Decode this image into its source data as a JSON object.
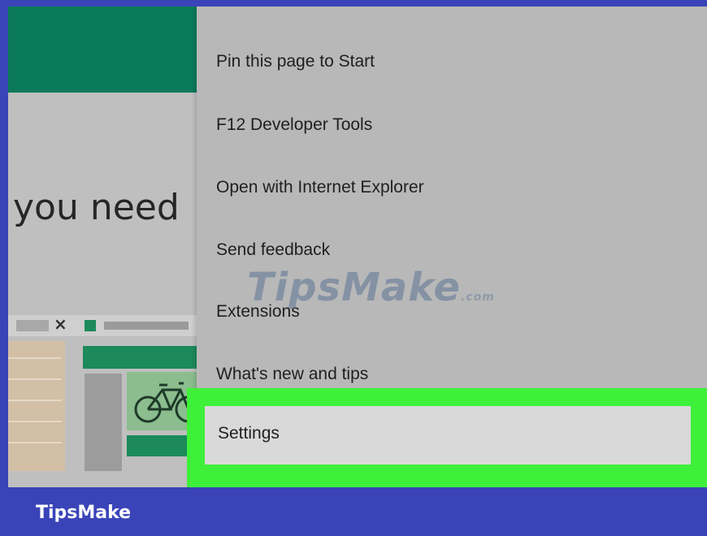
{
  "page": {
    "heading": "you need"
  },
  "menu": {
    "items": [
      {
        "label": "Pin this page to Start"
      },
      {
        "label": "F12 Developer Tools"
      },
      {
        "label": "Open with Internet Explorer"
      },
      {
        "label": "Send feedback"
      },
      {
        "label": "Extensions"
      },
      {
        "label": "What's new and tips"
      }
    ],
    "settings_label": "Settings"
  },
  "footer": {
    "brand": "TipsMake"
  },
  "watermark": {
    "text": "TipsMake",
    "suffix": ".com"
  },
  "colors": {
    "frame": "#3a44b8",
    "highlight": "#3ef03a",
    "page_header": "#0b7a5a"
  },
  "icons": {
    "tab_close": "close-icon",
    "illustration": "bicycle-icon"
  }
}
